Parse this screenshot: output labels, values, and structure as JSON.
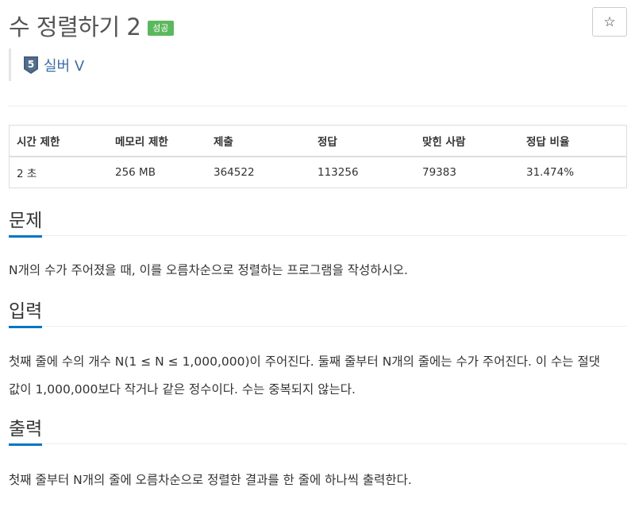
{
  "problem": {
    "title": "수 정렬하기 2",
    "badge": "성공",
    "star_icon": "star-icon",
    "star_glyph": "☆",
    "tier_number": "5",
    "tier_label": "실버 V"
  },
  "stats": {
    "headers": [
      "시간 제한",
      "메모리 제한",
      "제출",
      "정답",
      "맞힌 사람",
      "정답 비율"
    ],
    "values": [
      "2 초",
      "256 MB",
      "364522",
      "113256",
      "79383",
      "31.474%"
    ]
  },
  "sections": {
    "problem_heading": "문제",
    "problem_text": "N개의 수가 주어졌을 때, 이를 오름차순으로 정렬하는 프로그램을 작성하시오.",
    "input_heading": "입력",
    "input_line1": "첫째 줄에 수의 개수 N(1 ≤ N ≤ 1,000,000)이 주어진다. 둘째 줄부터 N개의 줄에는 수가 주어진다. 이 수는 절댓",
    "input_line2": "값이 1,000,000보다 작거나 같은 정수이다. 수는 중복되지 않는다.",
    "output_heading": "출력",
    "output_text": "첫째 줄부터 N개의 줄에 오름차순으로 정렬한 결과를 한 줄에 하나씩 출력한다."
  },
  "colors": {
    "badge_success": "#5cb85c",
    "heading_underline": "#0076c0",
    "tier_silver": "#435f7a"
  }
}
